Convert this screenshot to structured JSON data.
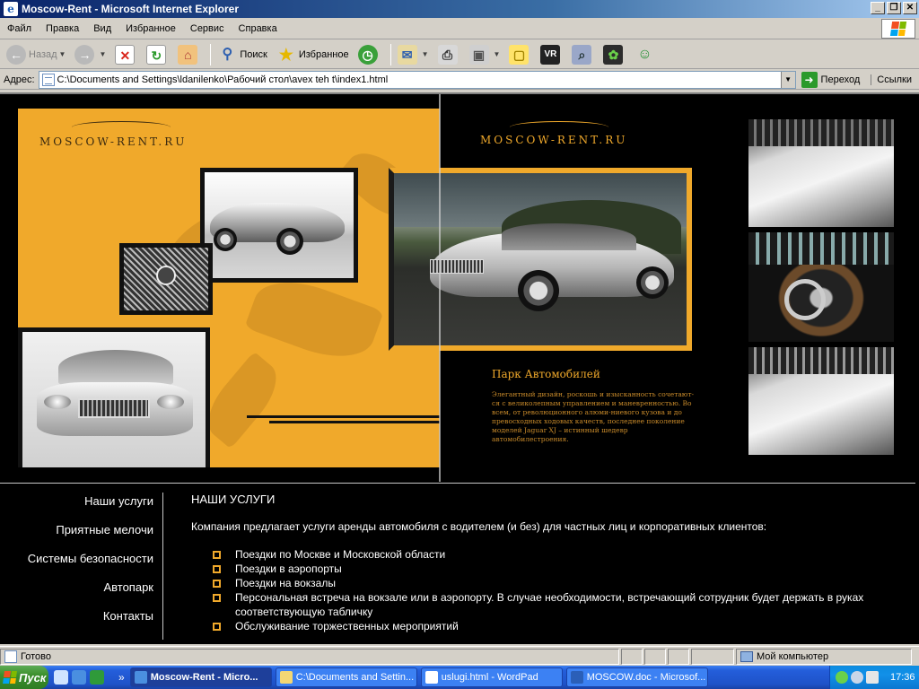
{
  "window": {
    "title": "Moscow-Rent - Microsoft Internet Explorer",
    "buttons": [
      "_",
      "❐",
      "✕"
    ]
  },
  "menu": [
    "Файл",
    "Правка",
    "Вид",
    "Избранное",
    "Сервис",
    "Справка"
  ],
  "toolbar": {
    "back_label": "Назад",
    "search_label": "Поиск",
    "favorites_label": "Избранное"
  },
  "address": {
    "label": "Адрес:",
    "value": "C:\\Documents and Settings\\ldanilenko\\Рабочий стол\\avex teh t\\index1.html",
    "go_label": "Переход",
    "links_label": "Ссылки"
  },
  "site": {
    "logo_left": "MOSCOW-RENT.RU",
    "logo_right": "MOSCOW-RENT.RU",
    "park_title": "Парк Автомобилей",
    "park_text": "Элегантный дизайн, роскошь и изысканность сочетают-ся с великолепным управлением и маневренностью. Во всем, от революционного алюми-ниевого кузова и до превосходных ходовых качеств, последнее поколение моделей Jaguar XJ – истинный шедевр автомобилестроения.",
    "nav": [
      "Наши услуги",
      "Приятные мелочи",
      "Системы безопасности",
      "Автопарк",
      "Контакты"
    ],
    "content": {
      "heading": "НАШИ УСЛУГИ",
      "intro": "Компания предлагает услуги аренды автомобиля с водителем (и без) для частных лиц и корпоративных клиентов:",
      "items": [
        "Поездки по Москве и Московской области",
        "Поездки в аэропорты",
        "Поездки на вокзалы",
        "Персональная встреча на вокзале или в аэропорту. В случае необходимости, встречающий сотрудник будет держать в руках соответствующую табличку",
        "Обслуживание торжественных мероприятий"
      ]
    }
  },
  "status": {
    "text": "Готово",
    "zone": "Мой компьютер"
  },
  "taskbar": {
    "start_label": "Пуск",
    "more": "»",
    "tasks": [
      "Moscow-Rent - Micro...",
      "C:\\Documents and Settin...",
      "uslugi.html - WordPad",
      "MOSCOW.doc - Microsof..."
    ],
    "clock": "17:36"
  },
  "colors": {
    "accent_orange": "#f0a92b",
    "page_bg": "#000000",
    "xp_blue": "#245edb"
  }
}
